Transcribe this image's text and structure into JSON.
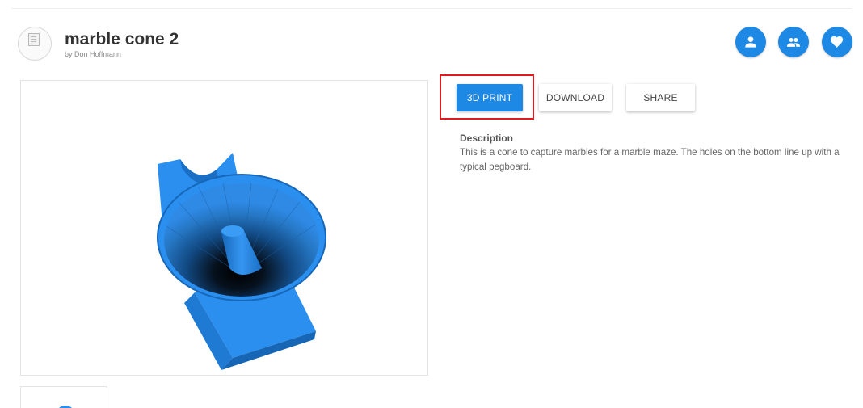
{
  "header": {
    "title": "marble cone 2",
    "byline": "by Don Hoffmann",
    "icons": [
      "person-icon",
      "group-icon",
      "heart-icon"
    ]
  },
  "actions": {
    "print_label": "3D PRINT",
    "download_label": "DOWNLOAD",
    "share_label": "SHARE",
    "highlighted": "3D PRINT"
  },
  "description": {
    "heading": "Description",
    "text": "This is a cone to capture marbles for a marble maze. The holes on the bottom line up with a typical pegboard."
  },
  "colors": {
    "accent": "#1e88e5",
    "model": "#2b8ff0",
    "highlight": "#e0191f"
  }
}
